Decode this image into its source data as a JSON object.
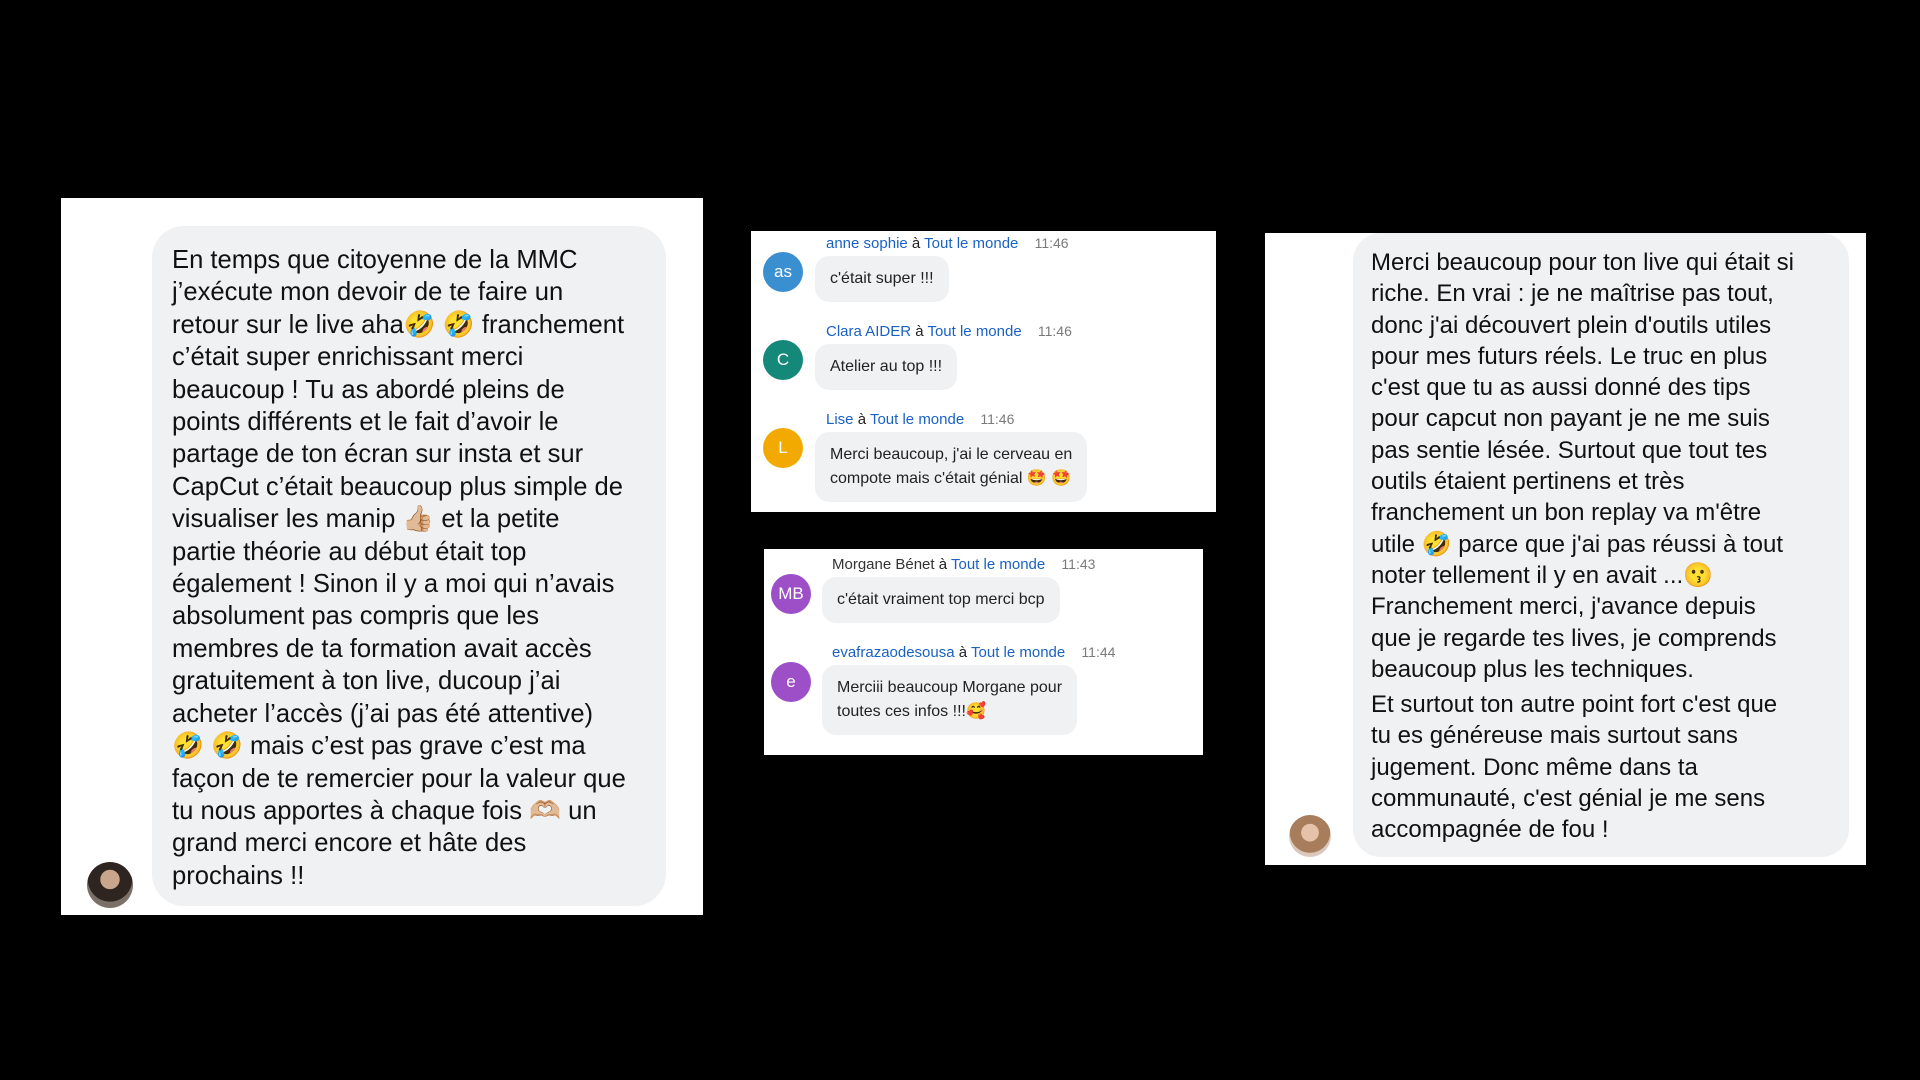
{
  "panel1": {
    "message": "En temps que citoyenne de la MMC\nj’exécute mon devoir de te faire un\nretour sur le live aha🤣 🤣 franchement\nc’était super enrichissant merci\nbeaucoup ! Tu as abordé pleins de\npoints différents et le fait d’avoir le\npartage de ton écran sur insta et sur\nCapCut c’était beaucoup plus simple de\nvisualiser les manip 👍🏼 et la petite\npartie théorie au début était top\négalement ! Sinon il y a moi qui n’avais\nabsolument pas compris que les\nmembres de ta formation avait accès\ngratuitement à ton live, ducoup j’ai\nacheter l’accès (j’ai pas été attentive)\n🤣 🤣 mais c’est pas grave c’est ma\nfaçon de te remercier pour la valeur que\ntu nous apportes à chaque fois 🫶🏼 un\ngrand merci encore et hâte des\nprochains !!"
  },
  "panel2": {
    "messages": [
      {
        "initials": "as",
        "color": "#3a8fd1",
        "sender": "anne sophie",
        "to": "à",
        "audience": "Tout le monde",
        "time": "11:46",
        "text": "c'était super !!!"
      },
      {
        "initials": "C",
        "color": "#14897a",
        "sender": "Clara AIDER",
        "to": "à",
        "audience": "Tout le monde",
        "time": "11:46",
        "text": "Atelier au top !!!"
      },
      {
        "initials": "L",
        "color": "#f2a900",
        "sender": "Lise",
        "to": "à",
        "audience": "Tout le monde",
        "time": "11:46",
        "text": "Merci beaucoup, j'ai le cerveau en\ncompote mais c'était génial 🤩 🤩"
      }
    ]
  },
  "panel3": {
    "messages": [
      {
        "initials": "MB",
        "color": "#9c4fc7",
        "sender": "Morgane Bénet",
        "to": "à",
        "audience": "Tout le monde",
        "time": "11:43",
        "text": "c'était vraiment top merci bcp"
      },
      {
        "initials": "e",
        "color": "#9c4fc7",
        "sender": "evafrazaodesousa",
        "to": "à",
        "audience": "Tout le monde",
        "time": "11:44",
        "text": "Merciii beaucoup Morgane pour\ntoutes ces infos !!!🥰"
      }
    ]
  },
  "panel4": {
    "para1": "Merci beaucoup pour ton live qui était si\nriche. En vrai : je ne maîtrise pas tout,\ndonc j'ai découvert plein d'outils utiles\npour mes futurs réels. Le truc en plus\nc'est que tu as aussi donné des tips\npour capcut non payant je ne me suis\npas sentie lésée. Surtout que tout tes\noutils étaient pertinens et très\nfranchement un bon replay va m'être\nutile 🤣 parce que j'ai pas réussi à tout\nnoter tellement il y en avait ...😗\nFranchement merci, j'avance depuis\nque je regarde tes lives, je comprends\nbeaucoup plus les techniques.",
    "para2": "Et surtout ton autre point fort c'est que\ntu es généreuse mais surtout sans\njugement. Donc même dans ta\ncommunauté, c'est génial je me sens\naccompagnée de fou !"
  }
}
